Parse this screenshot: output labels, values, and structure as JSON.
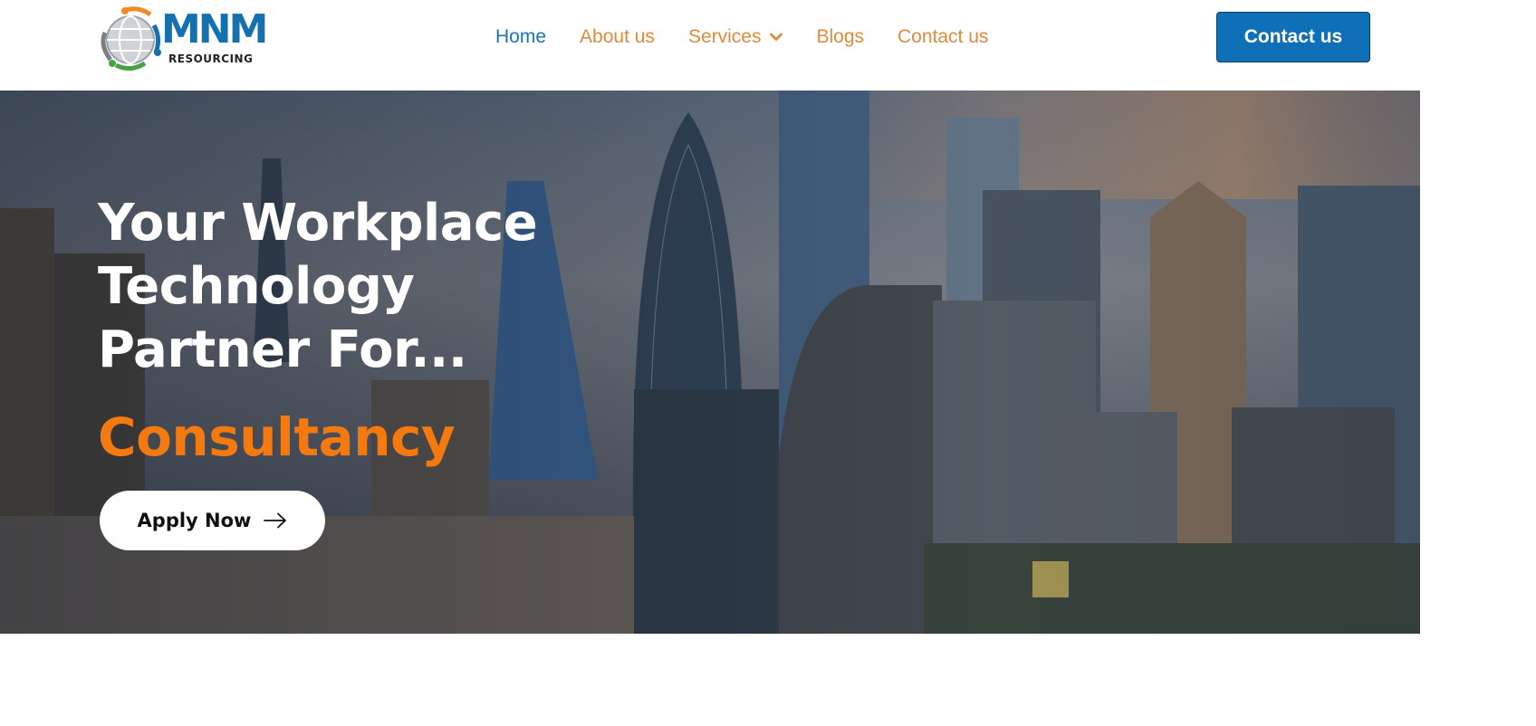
{
  "header": {
    "logo": {
      "primary": "MNM",
      "secondary": "RESOURCING"
    },
    "nav": [
      {
        "label": "Home",
        "active": true
      },
      {
        "label": "About us",
        "active": false
      },
      {
        "label": "Services",
        "active": false,
        "has_dropdown": true
      },
      {
        "label": "Blogs",
        "active": false
      },
      {
        "label": "Contact us",
        "active": false
      }
    ],
    "cta_label": "Contact us"
  },
  "hero": {
    "title_lines": [
      "Your Workplace",
      "Technology",
      "Partner For..."
    ],
    "accent_word": "Consultancy",
    "apply_label": "Apply Now"
  },
  "colors": {
    "brand_blue": "#0f6fb7",
    "nav_orange": "#e08a3c",
    "accent_orange": "#f47a10"
  },
  "icons": [
    "chevron-down-icon",
    "arrow-right-icon",
    "globe-logo-icon"
  ]
}
